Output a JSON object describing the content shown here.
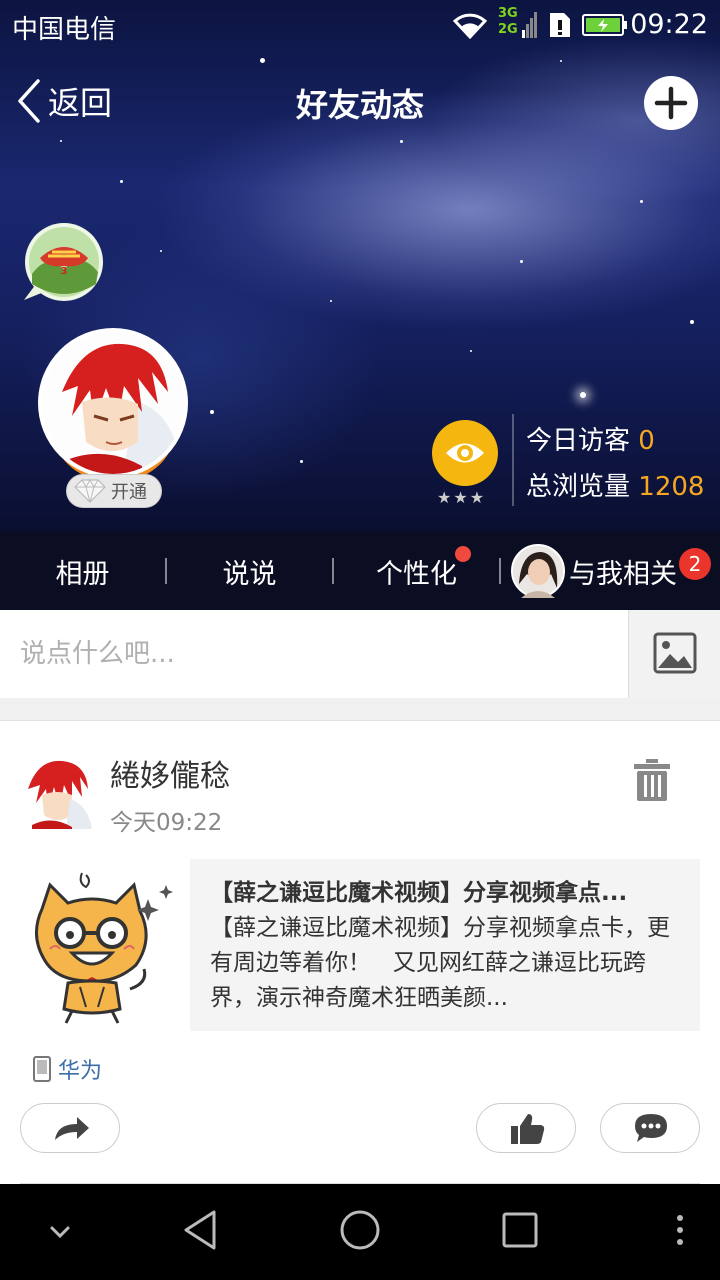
{
  "statusbar": {
    "carrier": "中国电信",
    "time": "09:22",
    "net1": "3G",
    "net2": "2G"
  },
  "nav": {
    "back_label": "返回",
    "title": "好友动态"
  },
  "profile": {
    "vip_label": "开通",
    "stars": "★★★"
  },
  "stats": {
    "today_label": "今日访客",
    "today_value": "0",
    "total_label": "总浏览量",
    "total_value": "1208"
  },
  "tabs": [
    {
      "label": "相册"
    },
    {
      "label": "说说"
    },
    {
      "label": "个性化",
      "has_dot": true
    },
    {
      "label": "与我相关",
      "badge": "2"
    }
  ],
  "composer": {
    "placeholder": "说点什么吧..."
  },
  "post": {
    "author": "綣姼儱稔",
    "time": "今天09:22",
    "share_title": "【薛之谦逗比魔术视频】分享视频拿点...",
    "share_desc": "【薛之谦逗比魔术视频】分享视频拿点卡，更有周边等着你！ ￼ ￼ 又见网红薛之谦逗比玩跨界，演示神奇魔术狂晒美颜...",
    "device": "华为"
  },
  "colors": {
    "accent_orange": "#f5a623",
    "eye_yellow": "#f5b70f",
    "badge_red": "#e9352b",
    "link_blue": "#3c6eaa"
  }
}
